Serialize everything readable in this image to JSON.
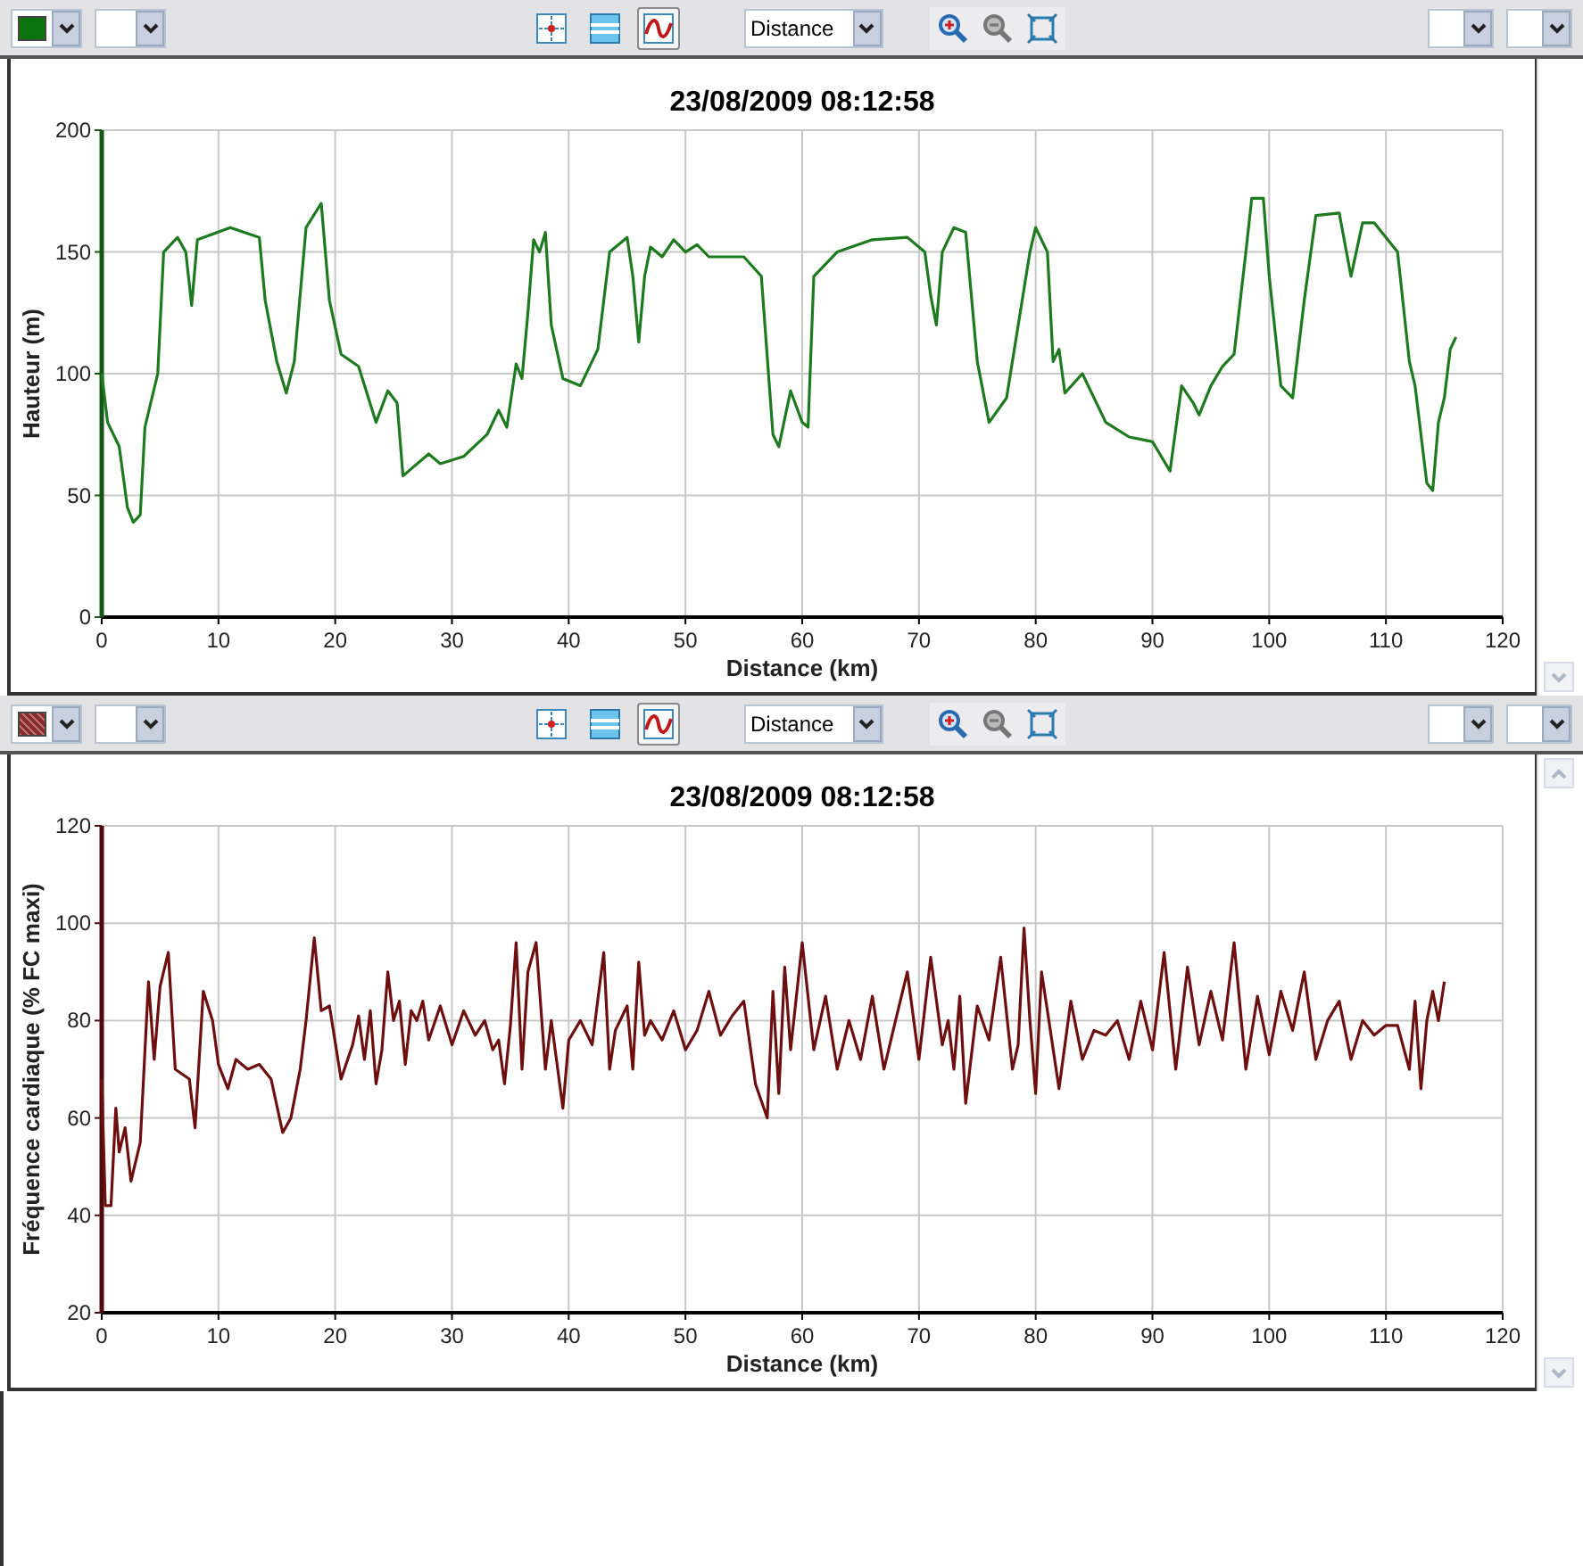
{
  "panels": [
    {
      "toolbar": {
        "swatch": {
          "color": "#0b730b",
          "kind": "solid"
        },
        "tools": [
          {
            "kind": "cursor",
            "selected": false
          },
          {
            "kind": "bands",
            "selected": false
          },
          {
            "kind": "curve",
            "selected": true
          }
        ],
        "axis_select": "Distance",
        "zoom": [
          {
            "kind": "zoom-in",
            "disabled": false
          },
          {
            "kind": "zoom-out",
            "disabled": true
          },
          {
            "kind": "fit",
            "disabled": false
          }
        ]
      },
      "chart_data": {
        "type": "line",
        "title": "23/08/2009 08:12:58",
        "xlabel": "Distance (km)",
        "ylabel": "Hauteur (m)",
        "grid": true,
        "xlim": [
          0,
          120
        ],
        "ylim": [
          0,
          200
        ],
        "xticks": [
          0,
          10,
          20,
          30,
          40,
          50,
          60,
          70,
          80,
          90,
          100,
          110,
          120
        ],
        "yticks": [
          0,
          50,
          100,
          150,
          200
        ],
        "x": [
          0,
          0.5,
          1.5,
          2.2,
          2.7,
          3.3,
          3.7,
          4.8,
          5.3,
          6.5,
          7.2,
          7.7,
          8.2,
          11,
          13.5,
          14,
          15,
          15.8,
          16.5,
          17.5,
          18.8,
          19.5,
          20.5,
          22,
          23.5,
          24.5,
          25.3,
          25.8,
          28,
          29,
          31,
          33,
          34,
          34.7,
          35.5,
          36,
          36.5,
          37,
          37.5,
          38,
          38.5,
          39.5,
          41,
          42.5,
          43.5,
          45,
          45.5,
          46,
          46.5,
          47,
          48,
          49,
          50,
          51,
          52,
          55,
          56.5,
          57.5,
          58,
          59,
          60,
          60.5,
          61,
          63,
          66,
          69,
          70.5,
          71,
          71.5,
          72,
          73,
          74,
          75,
          76,
          77.5,
          79.5,
          80,
          81,
          81.5,
          82,
          82.5,
          84,
          86,
          88,
          90,
          91.5,
          92.5,
          93.5,
          94,
          95,
          96,
          97,
          98,
          98.5,
          99.5,
          100,
          101,
          102,
          103,
          104,
          106,
          107,
          108,
          109,
          111,
          112,
          112.5,
          113.5,
          114,
          114.5,
          115,
          115.5,
          116
        ],
        "series": [
          {
            "color": "#1e7a1e",
            "values": [
              100,
              80,
              70,
              45,
              39,
              42,
              78,
              100,
              150,
              156,
              150,
              128,
              155,
              160,
              156,
              130,
              105,
              92,
              105,
              160,
              170,
              130,
              108,
              103,
              80,
              93,
              88,
              58,
              67,
              63,
              66,
              75,
              85,
              78,
              104,
              98,
              125,
              155,
              150,
              158,
              120,
              98,
              95,
              110,
              150,
              156,
              140,
              113,
              140,
              152,
              148,
              155,
              150,
              153,
              148,
              148,
              140,
              75,
              70,
              93,
              80,
              78,
              140,
              150,
              155,
              156,
              150,
              132,
              120,
              150,
              160,
              158,
              105,
              80,
              90,
              150,
              160,
              150,
              105,
              110,
              92,
              100,
              80,
              74,
              72,
              60,
              95,
              88,
              83,
              95,
              103,
              108,
              150,
              172,
              172,
              140,
              95,
              90,
              130,
              165,
              166,
              140,
              162,
              162,
              150,
              105,
              95,
              55,
              52,
              80,
              90,
              110,
              115
            ]
          }
        ]
      }
    },
    {
      "toolbar": {
        "swatch": {
          "color": "#8a2a2a",
          "kind": "hatched"
        },
        "tools": [
          {
            "kind": "cursor",
            "selected": false
          },
          {
            "kind": "bands",
            "selected": false
          },
          {
            "kind": "curve",
            "selected": true
          }
        ],
        "axis_select": "Distance",
        "zoom": [
          {
            "kind": "zoom-in",
            "disabled": false
          },
          {
            "kind": "zoom-out",
            "disabled": true
          },
          {
            "kind": "fit",
            "disabled": false
          }
        ]
      },
      "chart_data": {
        "type": "line",
        "title": "23/08/2009 08:12:58",
        "xlabel": "Distance (km)",
        "ylabel": "Fréquence cardiaque (% FC maxi)",
        "grid": true,
        "xlim": [
          0,
          120
        ],
        "ylim": [
          20,
          120
        ],
        "xticks": [
          0,
          10,
          20,
          30,
          40,
          50,
          60,
          70,
          80,
          90,
          100,
          110,
          120
        ],
        "yticks": [
          20,
          40,
          60,
          80,
          100,
          120
        ],
        "x": [
          0,
          0.3,
          0.8,
          1.2,
          1.5,
          2,
          2.5,
          3.3,
          4,
          4.5,
          5,
          5.7,
          6.3,
          7.5,
          8,
          8.7,
          9.5,
          10,
          10.8,
          11.5,
          12.5,
          13.5,
          14.5,
          15.5,
          16.2,
          17,
          17.5,
          18.2,
          18.8,
          19.5,
          20.5,
          21.5,
          22,
          22.5,
          23,
          23.5,
          24,
          24.5,
          25,
          25.5,
          26,
          26.5,
          27,
          27.5,
          28,
          29,
          30,
          31,
          32,
          32.8,
          33.5,
          34,
          34.5,
          35,
          35.5,
          36,
          36.5,
          37.2,
          38,
          38.5,
          39.5,
          40,
          41,
          42,
          43,
          43.5,
          44,
          45,
          45.5,
          46,
          46.5,
          47,
          48,
          49,
          50,
          51,
          52,
          53,
          54,
          55,
          56,
          57,
          57.5,
          58,
          58.5,
          59,
          60,
          61,
          62,
          63,
          64,
          65,
          66,
          67,
          68,
          69,
          70,
          71,
          72,
          72.5,
          73,
          73.5,
          74,
          75,
          76,
          77,
          78,
          78.5,
          79,
          79.5,
          80,
          80.5,
          81,
          82,
          83,
          84,
          85,
          86,
          87,
          88,
          89,
          90,
          91,
          92,
          93,
          94,
          95,
          96,
          97,
          98,
          99,
          100,
          101,
          102,
          103,
          104,
          105,
          106,
          107,
          108,
          109,
          110,
          111,
          112,
          112.5,
          113,
          113.5,
          114,
          114.5,
          115
        ],
        "series": [
          {
            "color": "#6e0f0f",
            "values": [
              68,
              42,
              42,
              62,
              53,
              58,
              47,
              55,
              88,
              72,
              87,
              94,
              70,
              68,
              58,
              86,
              80,
              71,
              66,
              72,
              70,
              71,
              68,
              57,
              60,
              70,
              80,
              97,
              82,
              83,
              68,
              75,
              81,
              72,
              82,
              67,
              74,
              90,
              80,
              84,
              71,
              82,
              80,
              84,
              76,
              83,
              75,
              82,
              77,
              80,
              74,
              76,
              67,
              79,
              96,
              70,
              90,
              96,
              70,
              80,
              62,
              76,
              80,
              75,
              94,
              70,
              78,
              83,
              70,
              92,
              77,
              80,
              76,
              82,
              74,
              78,
              86,
              77,
              81,
              84,
              67,
              60,
              86,
              65,
              91,
              74,
              96,
              74,
              85,
              70,
              80,
              72,
              85,
              70,
              80,
              90,
              72,
              93,
              75,
              80,
              70,
              85,
              63,
              83,
              76,
              93,
              70,
              75,
              99,
              80,
              65,
              90,
              82,
              66,
              84,
              72,
              78,
              77,
              80,
              72,
              84,
              74,
              94,
              70,
              91,
              75,
              86,
              76,
              96,
              70,
              85,
              73,
              86,
              78,
              90,
              72,
              80,
              84,
              72,
              80,
              77,
              79,
              79,
              70,
              84,
              66,
              80,
              86,
              80,
              88
            ]
          }
        ]
      }
    }
  ]
}
